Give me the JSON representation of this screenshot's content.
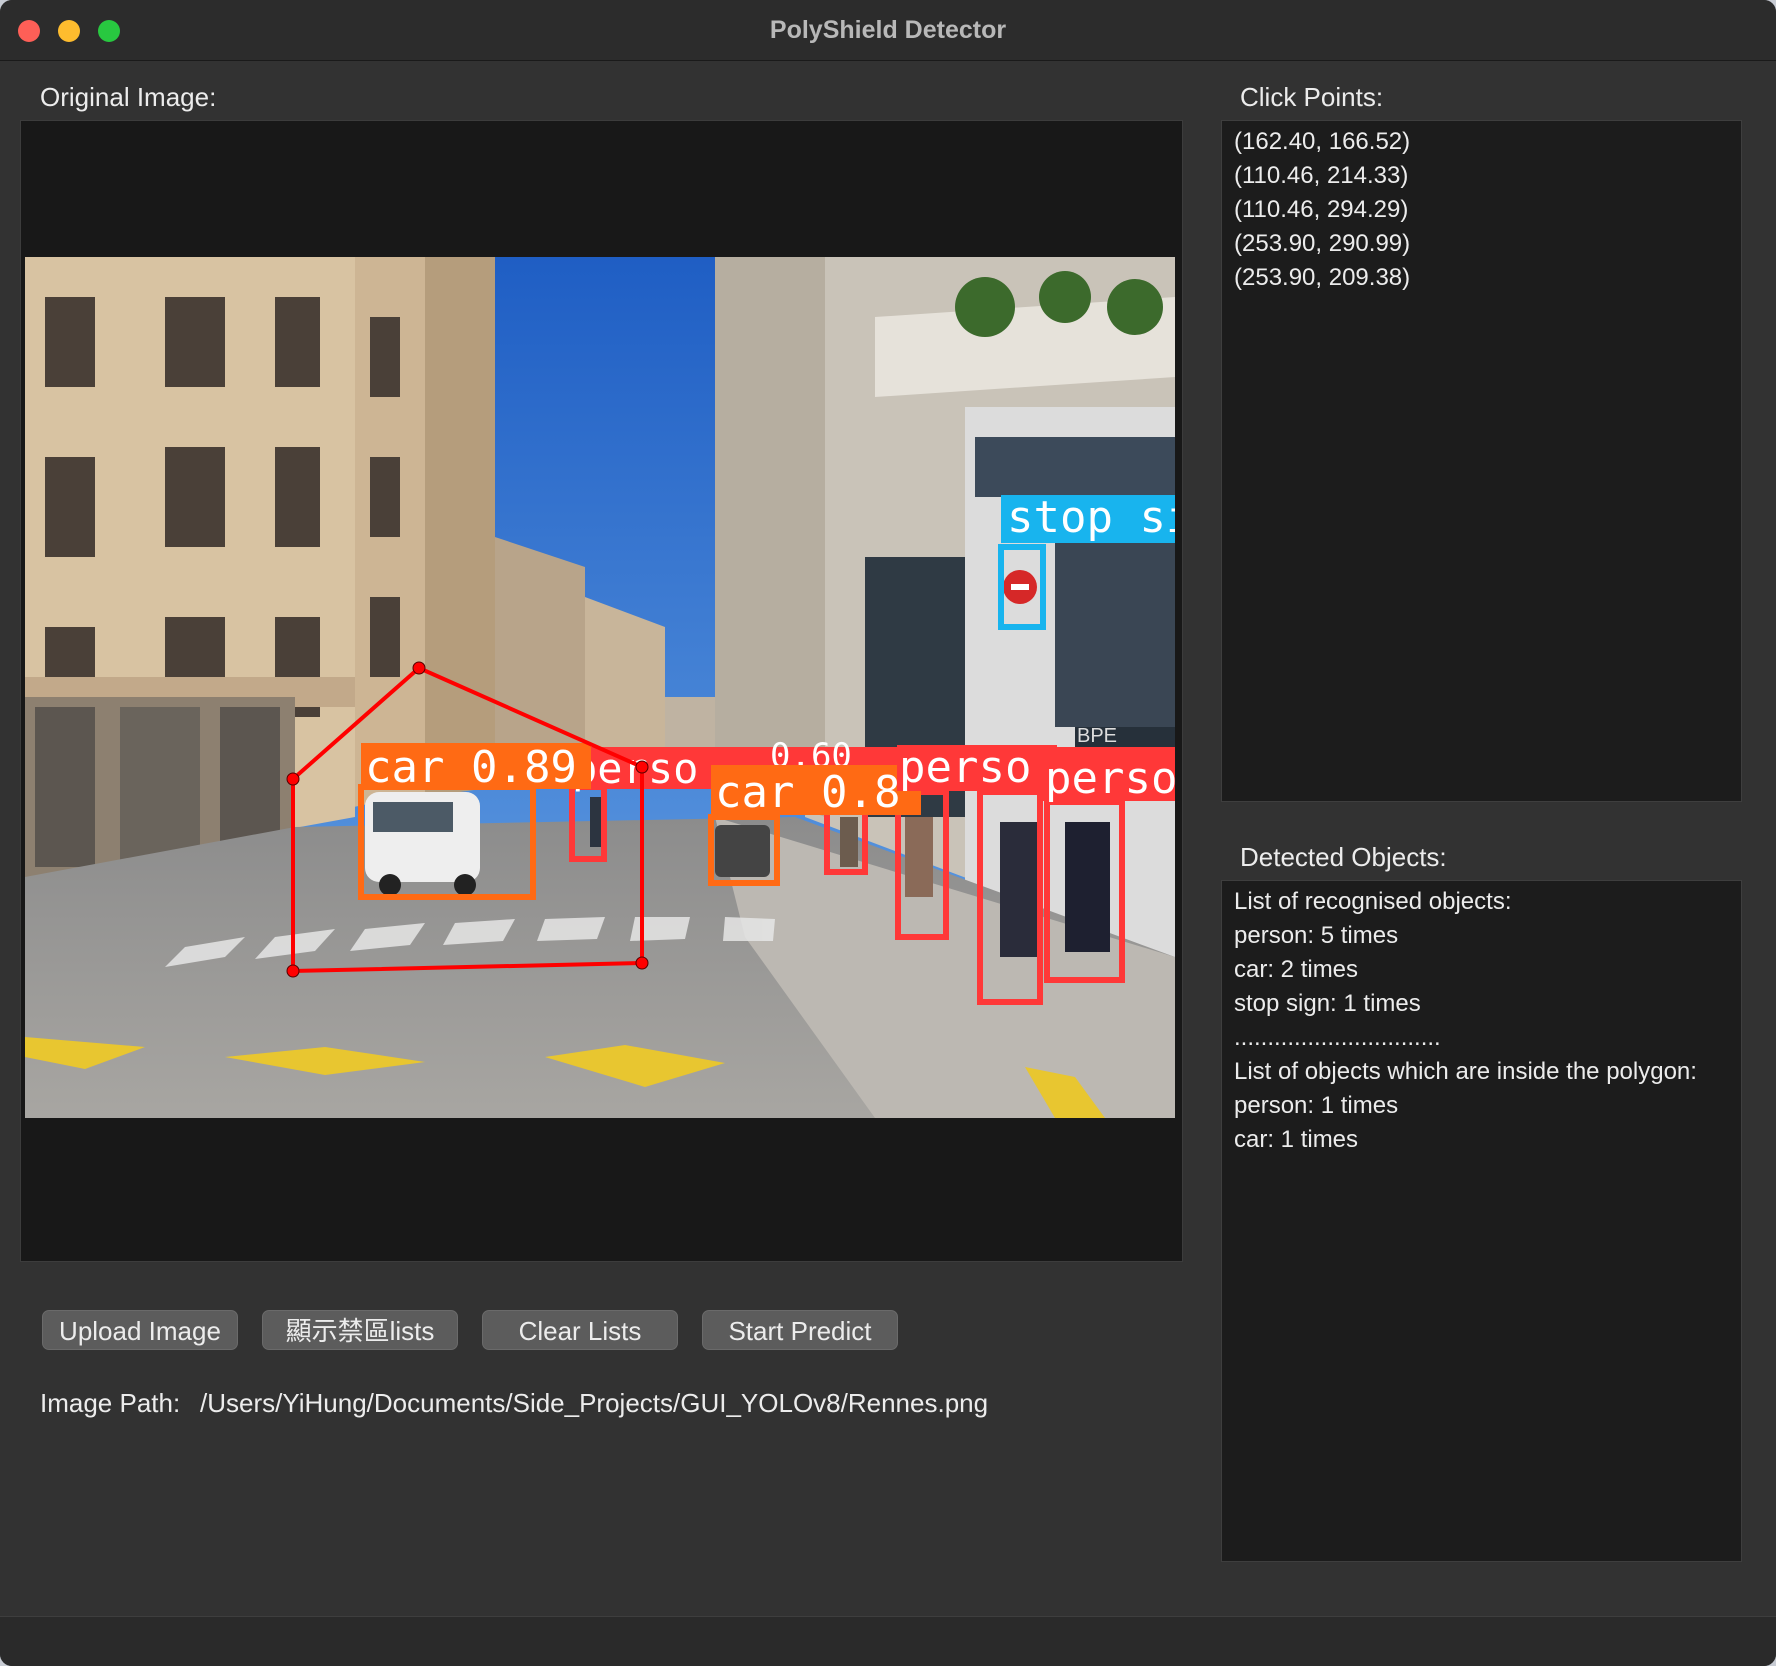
{
  "window": {
    "title": "PolyShield Detector"
  },
  "original_image": {
    "label": "Original Image:",
    "detections": [
      {
        "label": "car 0.89",
        "class": "car"
      },
      {
        "label": "perso",
        "class": "person"
      },
      {
        "label": "car 0.8",
        "class": "car"
      },
      {
        "label": "0.60",
        "class": "person"
      },
      {
        "label": "perso",
        "class": "person"
      },
      {
        "label": "perso",
        "class": "person"
      },
      {
        "label": "stop si",
        "class": "stop sign"
      }
    ],
    "shop_sign": "BPE"
  },
  "click_points": {
    "label": "Click Points:",
    "items": [
      "(162.40, 166.52)",
      "(110.46, 214.33)",
      "(110.46, 294.29)",
      "(253.90, 290.99)",
      "(253.90, 209.38)"
    ]
  },
  "detected_objects": {
    "label": "Detected Objects:",
    "lines": [
      "List of recognised objects:",
      "person: 5 times",
      "car: 2 times",
      "stop sign: 1 times",
      "...............................",
      "List of objects which are inside the polygon:",
      "person: 1 times",
      "car: 1 times"
    ]
  },
  "buttons": {
    "upload": "Upload Image",
    "show_lists": "顯示禁區lists",
    "clear": "Clear Lists",
    "predict": "Start Predict"
  },
  "image_path": {
    "label": "Image Path:",
    "value": "/Users/YiHung/Documents/Side_Projects/GUI_YOLOv8/Rennes.png"
  },
  "colors": {
    "car_box": "#ff6a14",
    "person_box": "#ff3838",
    "stop_box": "#18b4ee",
    "polygon": "#ff0000"
  }
}
